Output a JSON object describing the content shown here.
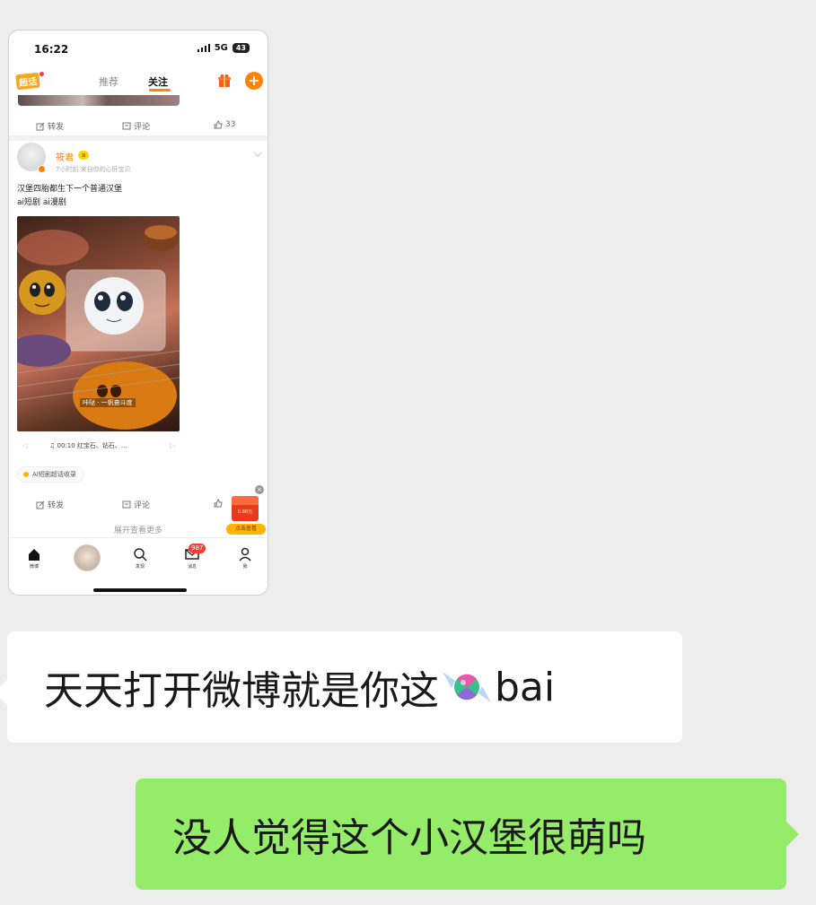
{
  "chat": {
    "incoming_text": "天天打开微博就是你这",
    "incoming_suffix": "bai",
    "incoming_emoji": "candy-emoji",
    "outgoing_text": "没人觉得这个小汉堡很萌吗"
  },
  "screenshot": {
    "status": {
      "time": "16:22",
      "network": "5G",
      "battery": "43"
    },
    "nav": {
      "supertopic": "超话",
      "tab_recommend": "推荐",
      "tab_follow": "关注"
    },
    "prev_post_actions": {
      "repost": "转发",
      "comment": "评论",
      "like_count": "33"
    },
    "post": {
      "username": "筱君",
      "vip_level": "a",
      "meta": "7小时前  来自你的心肝宝贝",
      "text_line1": "汉堡四胎都生下一个普通汉堡",
      "text_line2": "ai短剧 ai漫剧",
      "image_caption": "咔哒 · 一帆奋斗度",
      "music_info": "♫ 00:10 红宝石、钻石、...",
      "topic_tag": "AI短剧超话收录",
      "actions": {
        "repost": "转发",
        "comment": "评论"
      },
      "expand": "展开查看更多"
    },
    "red_packet": {
      "amount": "0.88元",
      "label": "点击查看"
    },
    "tabbar": {
      "home": "微博",
      "discover": "发现",
      "messages": "消息",
      "messages_badge": "987",
      "me": "我"
    }
  },
  "colors": {
    "accent": "#ff8200",
    "outgoing_bubble": "#95ec69",
    "chat_bg": "#ededed"
  }
}
